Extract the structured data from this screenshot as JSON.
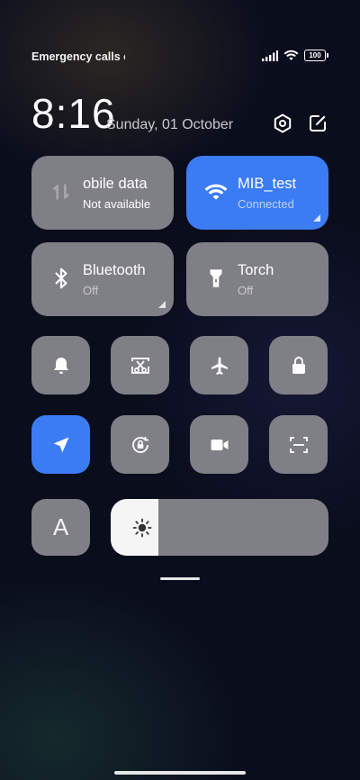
{
  "status_bar": {
    "carrier_text": "Emergency calls o",
    "battery_level": "100",
    "icons": [
      "signal-icon",
      "wifi-icon",
      "battery-icon"
    ]
  },
  "header": {
    "time": "8:16",
    "date": "Sunday, 01 October",
    "icons": [
      "settings-icon",
      "edit-icon"
    ]
  },
  "big_tiles": [
    {
      "name": "mobile-data",
      "title": "obile data",
      "subtitle": "Not available",
      "active": false,
      "icon": "mobile-data-icon"
    },
    {
      "name": "wifi",
      "title": "MIB_test",
      "subtitle": "Connected",
      "active": true,
      "icon": "wifi-icon"
    },
    {
      "name": "bluetooth",
      "title": "Bluetooth",
      "subtitle": "Off",
      "active": false,
      "icon": "bluetooth-icon"
    },
    {
      "name": "torch",
      "title": "Torch",
      "subtitle": "Off",
      "active": false,
      "icon": "torch-icon"
    }
  ],
  "small_tiles": [
    {
      "name": "notifications",
      "icon": "bell-icon",
      "active": false
    },
    {
      "name": "screenshot",
      "icon": "scissors-screenshot-icon",
      "active": false
    },
    {
      "name": "airplane-mode",
      "icon": "airplane-icon",
      "active": false
    },
    {
      "name": "lock-screen",
      "icon": "lock-icon",
      "active": false
    },
    {
      "name": "location",
      "icon": "location-arrow-icon",
      "active": true
    },
    {
      "name": "auto-rotate",
      "icon": "rotation-lock-icon",
      "active": false
    },
    {
      "name": "screen-recorder",
      "icon": "video-camera-icon",
      "active": false
    },
    {
      "name": "scanner",
      "icon": "scan-icon",
      "active": false
    }
  ],
  "bottom_row": {
    "font_tile_label": "A",
    "brightness_level": 0.22
  },
  "colors": {
    "accent": "#3b7cf5",
    "tile": "#7f7f86",
    "background": "#0a0d1c"
  }
}
